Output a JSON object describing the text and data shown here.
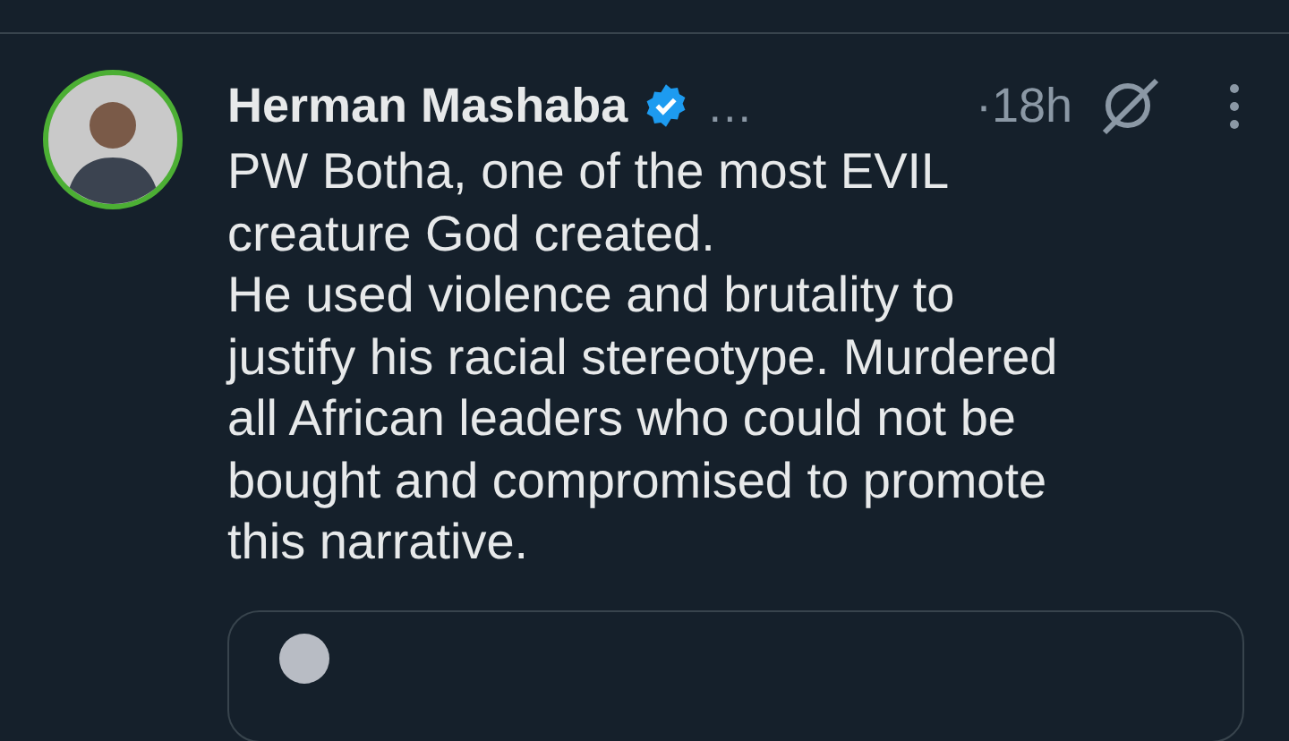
{
  "post": {
    "author": "Herman Mashaba",
    "verified": true,
    "handle": "…",
    "time": "·18h",
    "lines": [
      "PW Botha, one of the most EVIL",
      "creature God created.",
      "He used violence and brutality to",
      "justify his racial stereotype. Murdered",
      "all African leaders who could not be",
      "bought and compromised to promote",
      "this narrative."
    ]
  }
}
